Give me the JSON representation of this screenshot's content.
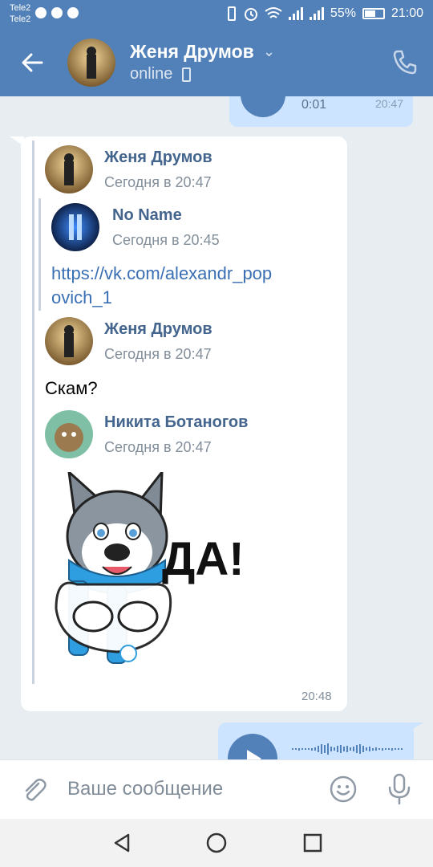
{
  "status_bar": {
    "carrier_1": "Tele2",
    "carrier_2": "Tele2",
    "battery": "55%",
    "time": "21:00"
  },
  "header": {
    "contact_name": "Женя Друмов",
    "contact_status": "online"
  },
  "messages": {
    "top_voice": {
      "duration": "0:01",
      "time": "20:47"
    },
    "incoming": {
      "fwd1": {
        "sender": "Женя Друмов",
        "date": "Сегодня в 20:47"
      },
      "fwd2": {
        "sender": "No Name",
        "date": "Сегодня в 20:45"
      },
      "link": "https://vk.com/alexandr_popovich_1",
      "fwd3": {
        "sender": "Женя Друмов",
        "date": "Сегодня в 20:47"
      },
      "text": "Скам?",
      "fwd4": {
        "sender": "Никита Ботаногов",
        "date": "Сегодня в 20:47"
      },
      "sticker_text": "ДА!",
      "time": "20:48"
    }
  },
  "composer": {
    "placeholder": "Ваше сообщение"
  },
  "colors": {
    "brand": "#5181b8",
    "sender": "#44658d",
    "link": "#3a6fb4",
    "outgoing_bubble": "#cce4ff"
  },
  "icons": [
    "back-arrow-icon",
    "chevron-down-icon",
    "mobile-phone-icon",
    "phone-call-icon",
    "paperclip-icon",
    "smile-icon",
    "microphone-icon",
    "nav-back-icon",
    "nav-home-icon",
    "nav-recents-icon"
  ]
}
